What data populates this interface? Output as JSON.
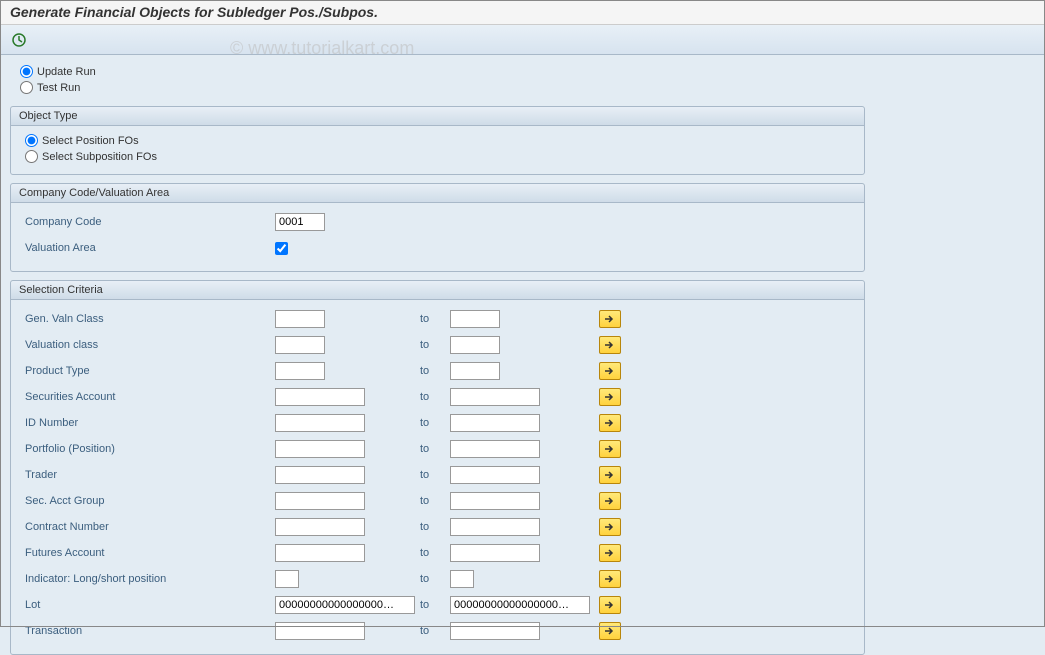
{
  "title": "Generate Financial Objects for Subledger Pos./Subpos.",
  "watermark": "© www.tutorialkart.com",
  "runOptions": {
    "update": "Update Run",
    "test": "Test Run"
  },
  "objectType": {
    "header": "Object Type",
    "position": "Select Position FOs",
    "subposition": "Select Subposition FOs"
  },
  "companyValuation": {
    "header": "Company Code/Valuation Area",
    "companyCode": {
      "label": "Company Code",
      "value": "0001"
    },
    "valuationArea": {
      "label": "Valuation Area"
    }
  },
  "selectionCriteria": {
    "header": "Selection Criteria",
    "toLabel": "to",
    "rows": [
      {
        "label": "Gen. Valn Class",
        "width": "small",
        "from": "",
        "to": ""
      },
      {
        "label": "Valuation class",
        "width": "small",
        "from": "",
        "to": ""
      },
      {
        "label": "Product Type",
        "width": "small",
        "from": "",
        "to": ""
      },
      {
        "label": "Securities Account",
        "width": "med",
        "from": "",
        "to": ""
      },
      {
        "label": "ID Number",
        "width": "med",
        "from": "",
        "to": ""
      },
      {
        "label": "Portfolio (Position)",
        "width": "med",
        "from": "",
        "to": ""
      },
      {
        "label": "Trader",
        "width": "med",
        "from": "",
        "to": ""
      },
      {
        "label": "Sec. Acct Group",
        "width": "med",
        "from": "",
        "to": ""
      },
      {
        "label": "Contract Number",
        "width": "med",
        "from": "",
        "to": ""
      },
      {
        "label": "Futures Account",
        "width": "med",
        "from": "",
        "to": ""
      },
      {
        "label": "Indicator: Long/short position",
        "width": "tiny",
        "from": "",
        "to": ""
      },
      {
        "label": "Lot",
        "width": "wide",
        "from": "00000000000000000…",
        "to": "00000000000000000…"
      },
      {
        "label": "Transaction",
        "width": "med",
        "from": "",
        "to": ""
      }
    ]
  }
}
